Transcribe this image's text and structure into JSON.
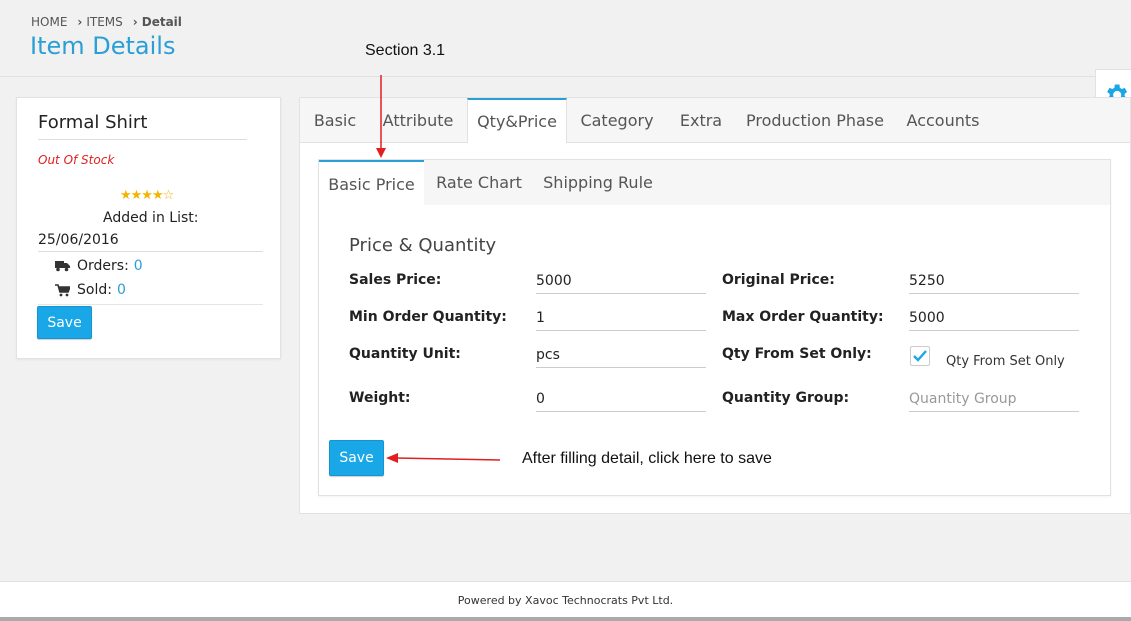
{
  "breadcrumb": {
    "home": "HOME",
    "items": "ITEMS",
    "current": "Detail"
  },
  "page_title": "Item Details",
  "annotations": {
    "section": "Section 3.1",
    "save_hint": "After filling detail, click here to save"
  },
  "product": {
    "name": "Formal Shirt",
    "stock_status": "Out Of Stock",
    "rating": "★★★★☆",
    "rating_value": 4,
    "rating_max": 5,
    "added_label": "Added in List:",
    "added_date": "25/06/2016",
    "orders_label": "Orders:",
    "orders_value": "0",
    "sold_label": "Sold:",
    "sold_value": "0",
    "save_label": "Save"
  },
  "tabs": [
    {
      "label": "Basic"
    },
    {
      "label": "Attribute"
    },
    {
      "label": "Qty&Price"
    },
    {
      "label": "Category"
    },
    {
      "label": "Extra"
    },
    {
      "label": "Production Phase"
    },
    {
      "label": "Accounts"
    }
  ],
  "subtabs": [
    {
      "label": "Basic Price"
    },
    {
      "label": "Rate Chart"
    },
    {
      "label": "Shipping Rule"
    }
  ],
  "form": {
    "section_title": "Price & Quantity",
    "sales_price_label": "Sales Price:",
    "sales_price_value": "5000",
    "original_price_label": "Original Price:",
    "original_price_value": "5250",
    "min_order_label": "Min Order Quantity:",
    "min_order_value": "1",
    "max_order_label": "Max Order Quantity:",
    "max_order_value": "5000",
    "qty_unit_label": "Quantity Unit:",
    "qty_unit_value": "pcs",
    "qty_set_label": "Qty From Set Only:",
    "qty_set_checkbox_label": "Qty From Set Only",
    "qty_set_checked": true,
    "weight_label": "Weight:",
    "weight_value": "0",
    "qty_group_label": "Quantity Group:",
    "qty_group_placeholder": "Quantity Group",
    "save_label": "Save"
  },
  "footer": {
    "text": "Powered by Xavoc Technocrats Pvt Ltd."
  },
  "colors": {
    "accent": "#2a9fd6",
    "button": "#1aa7e8",
    "out_of_stock": "#e02020",
    "star": "#f4b400",
    "arrow": "#e02020"
  }
}
